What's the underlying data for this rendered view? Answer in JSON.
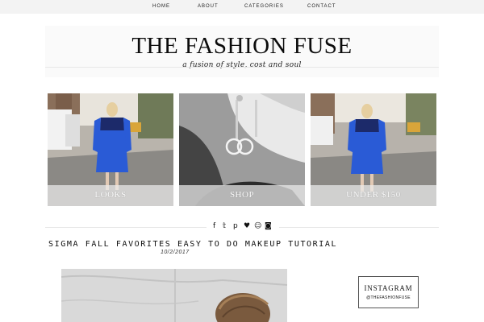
{
  "nav": {
    "items": [
      "HOME",
      "ABOUT",
      "CATEGORIES",
      "CONTACT"
    ]
  },
  "header": {
    "title": "THE FASHION FUSE",
    "tagline": "a fusion of style, cost and soul"
  },
  "feature_tiles": [
    {
      "label": "LOOKS",
      "image": "woman in blue fringe dress on city street"
    },
    {
      "label": "SHOP",
      "image": "black and white close-up of chanel earring"
    },
    {
      "label": "UNDER $150",
      "image": "woman in blue fringe dress on city street"
    }
  ],
  "social": {
    "icons": [
      "facebook-icon",
      "twitter-icon",
      "pinterest-icon",
      "heart-icon",
      "snapchat-icon",
      "instagram-icon"
    ],
    "glyphs": [
      "f",
      "𝕥",
      "p",
      "♥",
      "☺",
      "◙"
    ]
  },
  "post": {
    "title": "SIGMA FALL FAVORITES EASY TO DO MAKEUP TUTORIAL",
    "date": "10/2/2017"
  },
  "sidebar": {
    "instagram_title": "INSTAGRAM",
    "instagram_handle": "@THEFASHIONFUSE"
  },
  "colors": {
    "nav_bg": "#f3f3f3",
    "text": "#111111",
    "tile_label_bg": "rgba(235,235,235,0.72)",
    "dress_blue": "#2a5bd6"
  }
}
